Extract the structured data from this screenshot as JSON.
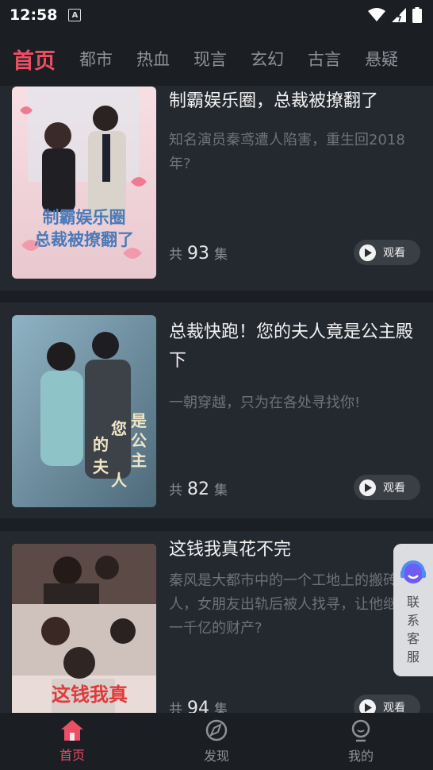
{
  "status_bar": {
    "time": "12:58",
    "sim_badge": "A"
  },
  "tabs": [
    "首页",
    "都市",
    "热血",
    "现言",
    "玄幻",
    "古言",
    "悬疑"
  ],
  "dramas": [
    {
      "title": "制霸娱乐圈，总裁被撩翻了",
      "description": "知名演员秦鸢遭人陷害，重生回2018年?",
      "episodes_prefix": "共",
      "episodes_count": "93",
      "episodes_suffix": "集",
      "watch_label": "观看",
      "cover_text": "制霸娱乐圈 总裁被撩翻了"
    },
    {
      "title": "总裁快跑！您的夫人竟是公主殿下",
      "description": "一朝穿越，只为在各处寻找你!",
      "episodes_prefix": "共",
      "episodes_count": "82",
      "episodes_suffix": "集",
      "watch_label": "观看",
      "cover_text": "您的夫人竟是公主殿下"
    },
    {
      "title": "这钱我真花不完",
      "description": "秦风是大都市中的一个工地上的搬砖人，女朋友出轨后被人找寻，让他继承一千亿的财产?",
      "episodes_prefix": "共",
      "episodes_count": "94",
      "episodes_suffix": "集",
      "watch_label": "观看",
      "cover_text": "这钱我真"
    }
  ],
  "customer_service": {
    "label": "联系客服"
  },
  "bottom_nav": [
    {
      "label": "首页",
      "icon": "home-icon",
      "active": true
    },
    {
      "label": "发现",
      "icon": "compass-icon",
      "active": false
    },
    {
      "label": "我的",
      "icon": "profile-icon",
      "active": false
    }
  ],
  "colors": {
    "accent": "#ec4f63",
    "background": "#1b1e23",
    "card": "#24282f"
  }
}
